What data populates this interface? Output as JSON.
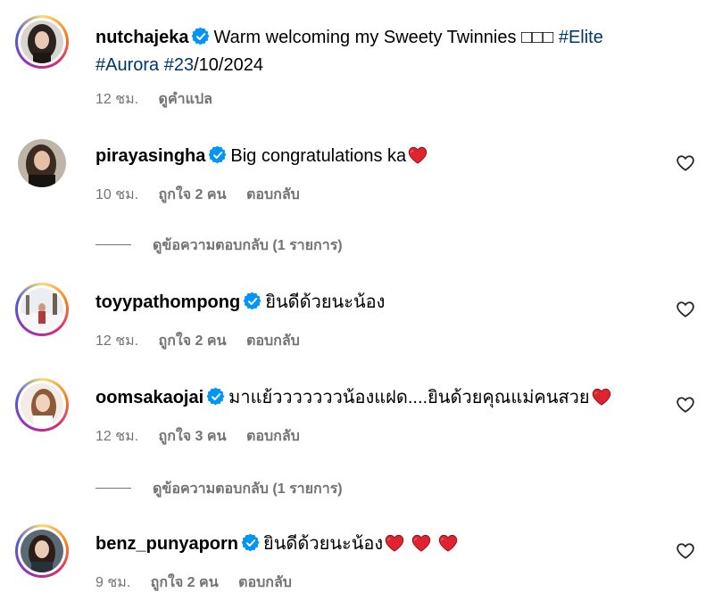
{
  "post": {
    "username": "nutchajeka",
    "caption_text": "Warm welcoming my Sweety Twinnies □□□",
    "tag_elite": "#Elite",
    "tag_aurora": "#Aurora",
    "tag_date_hash": "#23",
    "date_rest": "/10/2024",
    "time": "12 ชม.",
    "translate_label": "ดูคำแปล"
  },
  "comments": [
    {
      "username": "pirayasingha",
      "text": "Big congratulations ka",
      "time": "10 ชม.",
      "likes": "ถูกใจ 2 คน",
      "reply_label": "ตอบกลับ",
      "view_replies": "ดูข้อความตอบกลับ (1 รายการ)"
    },
    {
      "username": "toyypathompong",
      "text": "ยินดีด้วยนะน้อง",
      "time": "12 ชม.",
      "likes": "ถูกใจ 2 คน",
      "reply_label": "ตอบกลับ"
    },
    {
      "username": "oomsakaojai",
      "text": "มาแย้วววววววน้องแฝด....ยินด้วยคุณแม่คนสวย",
      "time": "12 ชม.",
      "likes": "ถูกใจ 3 คน",
      "reply_label": "ตอบกลับ",
      "view_replies": "ดูข้อความตอบกลับ (1 รายการ)"
    },
    {
      "username": "benz_punyaporn",
      "text": "ยินดีด้วยนะน้อง",
      "time": "9 ชม.",
      "likes": "ถูกใจ 2 คน",
      "reply_label": "ตอบกลับ"
    }
  ],
  "colors": {
    "link": "#00376b",
    "meta": "#737373",
    "verified": "#0095f6",
    "heart": "#e0242f"
  },
  "icons": {
    "verified": "verified-badge-icon",
    "like": "heart-outline-icon",
    "emoji_heart": "red-heart-emoji-icon"
  }
}
